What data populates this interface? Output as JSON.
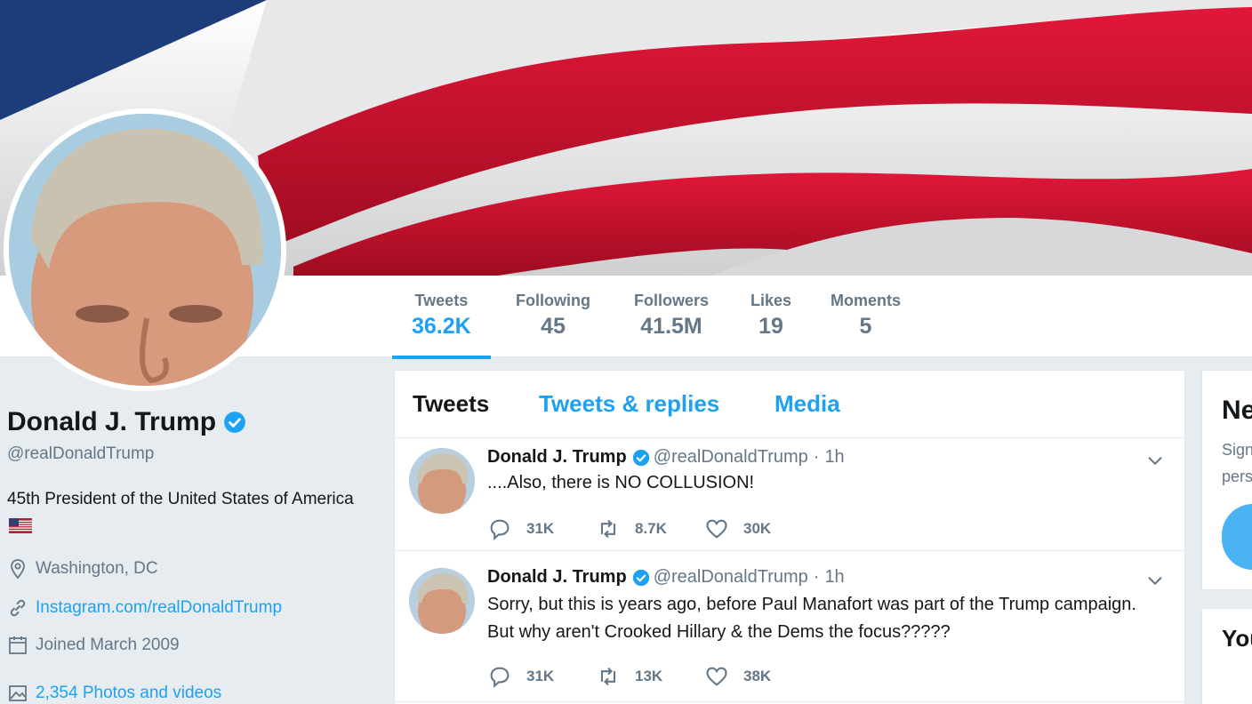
{
  "profile": {
    "name": "Donald J. Trump",
    "handle": "@realDonaldTrump",
    "bio": "45th President of the United States of America",
    "location": "Washington, DC",
    "website": "Instagram.com/realDonaldTrump",
    "joined": "Joined March 2009",
    "photos": "2,354 Photos and videos"
  },
  "stats": [
    {
      "label": "Tweets",
      "value": "36.2K"
    },
    {
      "label": "Following",
      "value": "45"
    },
    {
      "label": "Followers",
      "value": "41.5M"
    },
    {
      "label": "Likes",
      "value": "19"
    },
    {
      "label": "Moments",
      "value": "5"
    }
  ],
  "tabs": [
    "Tweets",
    "Tweets & replies",
    "Media"
  ],
  "tweets": [
    {
      "name": "Donald J. Trump",
      "handle": "@realDonaldTrump",
      "time": "1h",
      "text": "....Also, there is NO COLLUSION!",
      "replies": "31K",
      "retweets": "8.7K",
      "likes": "30K"
    },
    {
      "name": "Donald J. Trump",
      "handle": "@realDonaldTrump",
      "time": "1h",
      "text": "Sorry, but this is years ago, before Paul Manafort was part of the Trump campaign. But why aren't Crooked Hillary & the Dems the focus?????",
      "replies": "31K",
      "retweets": "13K",
      "likes": "38K"
    }
  ],
  "right": {
    "card1_title": "Ne",
    "card1_line1": "Sign",
    "card1_line2": "pers",
    "card2_title": "You"
  },
  "colors": {
    "accent": "#1da1f2",
    "banner_red": "#c8102e",
    "banner_blue": "#1d3c7a"
  },
  "icons": {
    "verified": "verified-badge-icon",
    "location": "location-pin-icon",
    "link": "link-icon",
    "calendar": "calendar-icon",
    "photos": "photos-icon",
    "reply": "reply-icon",
    "retweet": "retweet-icon",
    "like": "heart-icon",
    "caret": "chevron-down-icon"
  }
}
